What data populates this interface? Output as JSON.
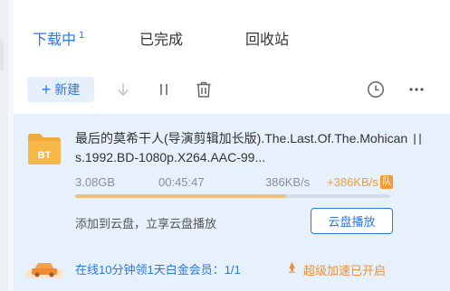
{
  "tabs": [
    {
      "label": "下载中",
      "badge": "1"
    },
    {
      "label": "已完成"
    },
    {
      "label": "回收站"
    }
  ],
  "toolbar": {
    "new_label": "新建",
    "icons": [
      "download-icon",
      "pause-all-icon",
      "trash-icon",
      "clock-icon",
      "more-icon"
    ]
  },
  "task": {
    "badge_text": "BT",
    "name": "最后的莫希干人(导演剪辑加长版).The.Last.Of.The.Mohicans.1992.BD-1080p.X264.AAC-99...",
    "size": "3.08GB",
    "time_remaining": "00:45:47",
    "speed": "386KB/s",
    "boost_speed": "+386KB/s",
    "boost_tag": "队",
    "progress": 0.67,
    "cloud_hint": "添加到云盘，立享云盘播放",
    "cloud_button": "云盘播放",
    "vip_promo": "在线10分钟领1天白金会员：1/1",
    "boost_status": "超级加速已开启"
  },
  "colors": {
    "accent": "#2a77e8",
    "card_bg": "#e7f1fc",
    "progress_fill": "#efc07e",
    "boost": "#f29b38"
  }
}
